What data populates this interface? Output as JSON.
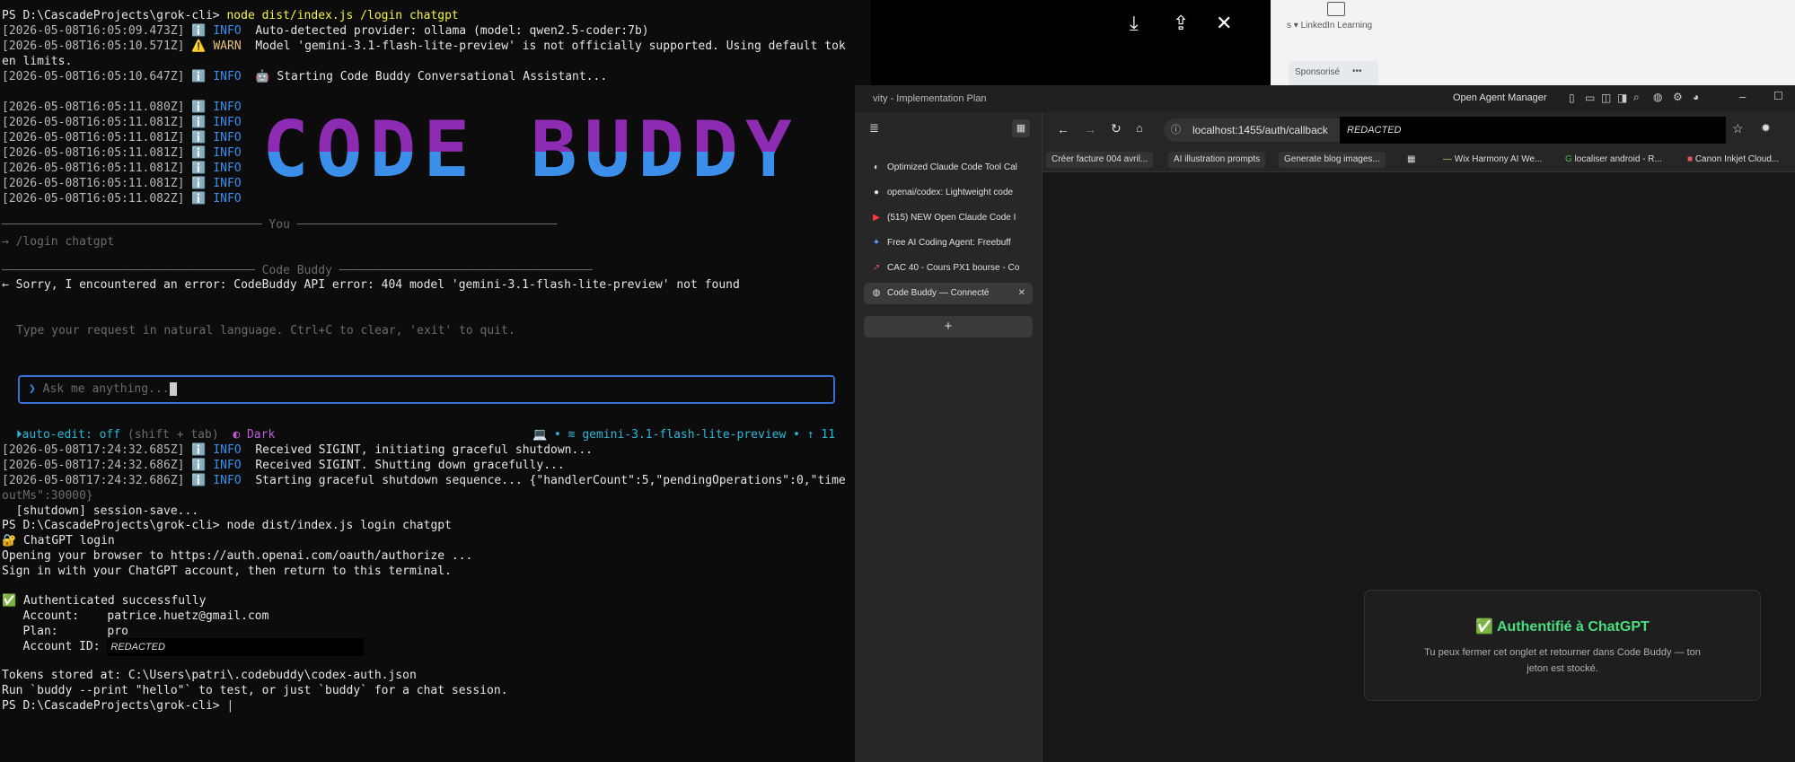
{
  "terminal": {
    "cmd1_prompt": "PS D:\\CascadeProjects\\grok-cli>",
    "cmd1": "node dist/index.js /login chatgpt",
    "logs1": [
      {
        "ts": "[2026-05-08T16:05:09.473Z]",
        "level": "ℹ️ INFO",
        "msg": "Auto-detected provider: ollama (model: qwen2.5-coder:7b)"
      },
      {
        "ts": "[2026-05-08T16:05:10.571Z]",
        "level": "⚠️ WARN",
        "msg": "Model 'gemini-3.1-flash-lite-preview' is not officially supported. Using default tok"
      },
      {
        "ts": "",
        "level": "",
        "msg": "en limits."
      },
      {
        "ts": "[2026-05-08T16:05:10.647Z]",
        "level": "ℹ️ INFO",
        "msg": "🤖 Starting Code Buddy Conversational Assistant..."
      }
    ],
    "logs2": [
      {
        "ts": "[2026-05-08T16:05:11.080Z]",
        "level": "ℹ️ INFO"
      },
      {
        "ts": "[2026-05-08T16:05:11.081Z]",
        "level": "ℹ️ INFO"
      },
      {
        "ts": "[2026-05-08T16:05:11.081Z]",
        "level": "ℹ️ INFO"
      },
      {
        "ts": "[2026-05-08T16:05:11.081Z]",
        "level": "ℹ️ INFO"
      },
      {
        "ts": "[2026-05-08T16:05:11.081Z]",
        "level": "ℹ️ INFO"
      },
      {
        "ts": "[2026-05-08T16:05:11.081Z]",
        "level": "ℹ️ INFO"
      },
      {
        "ts": "[2026-05-08T16:05:11.082Z]",
        "level": "ℹ️ INFO"
      }
    ],
    "banner": "CODE BUDDY",
    "you_divider": "───────────────────────────────────── You ─────────────────────────────────────",
    "you_msg": "→ /login chatgpt",
    "buddy_divider": "──────────────────────────────────── Code Buddy ────────────────────────────────────",
    "buddy_msg": "← Sorry, I encountered an error: CodeBuddy API error: 404 model 'gemini-3.1-flash-lite-preview' not found",
    "hint": "Type your request in natural language. Ctrl+C to clear, 'exit' to quit.",
    "input_placeholder": "Ask me anything...",
    "status_autoedit": "⏵auto-edit: off",
    "status_shift": "(shift + tab)",
    "status_theme": "◐ Dark",
    "status_model": "💻 • ≋ gemini-3.1-flash-lite-preview • ↑ 11",
    "logs3": [
      {
        "ts": "[2026-05-08T17:24:32.685Z]",
        "level": "ℹ️ INFO",
        "msg": "Received SIGINT, initiating graceful shutdown..."
      },
      {
        "ts": "[2026-05-08T17:24:32.686Z]",
        "level": "ℹ️ INFO",
        "msg": "Received SIGINT. Shutting down gracefully..."
      },
      {
        "ts": "[2026-05-08T17:24:32.686Z]",
        "level": "ℹ️ INFO",
        "msg": "Starting graceful shutdown sequence... {\"handlerCount\":5,\"pendingOperations\":0,\"time"
      }
    ],
    "timeout_line": "outMs\":30000}",
    "shutdown_line": "  [shutdown] session-save...",
    "cmd2_prompt": "PS D:\\CascadeProjects\\grok-cli>",
    "cmd2": "node dist/index.js login chatgpt",
    "chatgpt_login": "🔐 ChatGPT login",
    "opening": "Opening your browser to https://auth.openai.com/oauth/authorize ...",
    "signin": "Sign in with your ChatGPT account, then return to this terminal.",
    "auth_ok": "✅ Authenticated successfully",
    "account_label": "   Account:",
    "account_value": "patrice.huetz@gmail.com",
    "plan_label": "   Plan:",
    "plan_value": "pro",
    "account_id_label": "   Account ID:",
    "account_id_value": "REDACTED",
    "tokens": "Tokens stored at: C:\\Users\\patri\\.codebuddy\\codex-auth.json",
    "run_hint": "Run `buddy --print \"hello\"` to test, or just `buddy` for a chat session.",
    "cmd3_prompt": "PS D:\\CascadeProjects\\grok-cli>"
  },
  "viewer_toolbar": {
    "download": "⤓",
    "share": "⇪",
    "close": "✕"
  },
  "linkedin": {
    "learning": "LinkedIn Learning",
    "sponsored": "Sponsorisé",
    "prefix": "s ▾",
    "more": "•••"
  },
  "browser": {
    "window_title": "vity - Implementation Plan",
    "agent_manager": "Open Agent Manager",
    "url_host": "localhost:1455/auth/callback",
    "url_redacted": "REDACTED",
    "tabs": [
      {
        "icon": "◐",
        "label": "Optimized Claude Code Tool Cal"
      },
      {
        "icon": "●",
        "label": "openai/codex: Lightweight code"
      },
      {
        "icon": "▶",
        "label": "(515) NEW Open Claude Code I"
      },
      {
        "icon": "✦",
        "label": "Free AI Coding Agent: Freebuff"
      },
      {
        "icon": "↗",
        "label": "CAC 40 - Cours PX1 bourse - Co"
      },
      {
        "icon": "◍",
        "label": "Code Buddy — Connecté"
      }
    ],
    "new_tab": "+",
    "bookmarks": [
      "Créer facture 004 avril...",
      "AI illustration prompts",
      "Generate blog images...",
      "Wix Harmony AI We...",
      "localiser android - R...",
      "Canon Inkjet Cloud..."
    ],
    "auth_title": "✅ Authentifié à ChatGPT",
    "auth_body_1": "Tu peux fermer cet onglet et retourner dans Code Buddy — ton",
    "auth_body_2": "jeton est stocké."
  }
}
